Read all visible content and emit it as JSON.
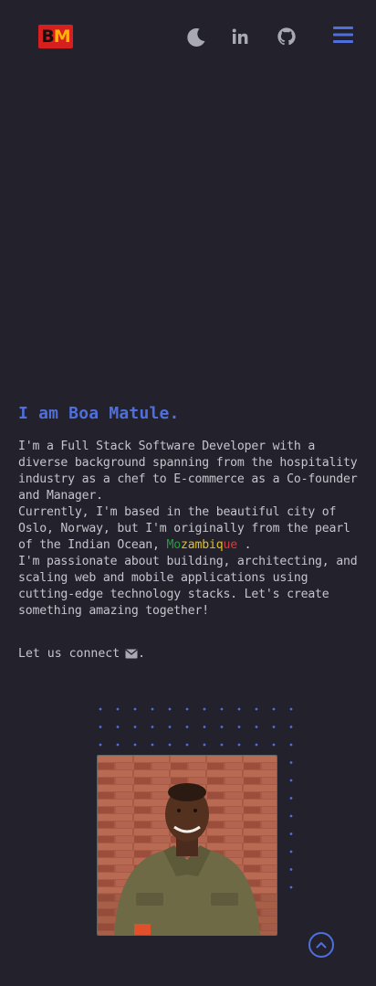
{
  "header": {
    "logo_text_b": "B",
    "logo_text_m": "M",
    "icons": [
      "moon-icon",
      "linkedin-icon",
      "github-icon",
      "hamburger-menu-icon"
    ],
    "accent_color": "#4f6fdd"
  },
  "hero": {
    "title": "I am Boa Matule.",
    "bio_1": "I'm a Full Stack Software Developer with a diverse background spanning from the hospitality industry as a chef to E-commerce as a Co-founder and Manager.",
    "bio_2_pre": "Currently, I'm based in the beautiful city of Oslo, Norway, but I'm originally from the pearl of the Indian Ocean, ",
    "moz_1": "Mo",
    "moz_2": "zambiq",
    "moz_3": "ue",
    "bio_2_post": " .",
    "bio_3": "I'm passionate about building, architecting, and scaling web and mobile applications using cutting-edge technology stacks. Let's create something amazing together!",
    "connect_label": "Let us connect",
    "connect_suffix": "."
  },
  "colors": {
    "background": "#22212c",
    "text": "#c5c5cc",
    "mozambique_green": "#22a03c",
    "mozambique_yellow": "#e0c020",
    "mozambique_red": "#d53b3b"
  }
}
